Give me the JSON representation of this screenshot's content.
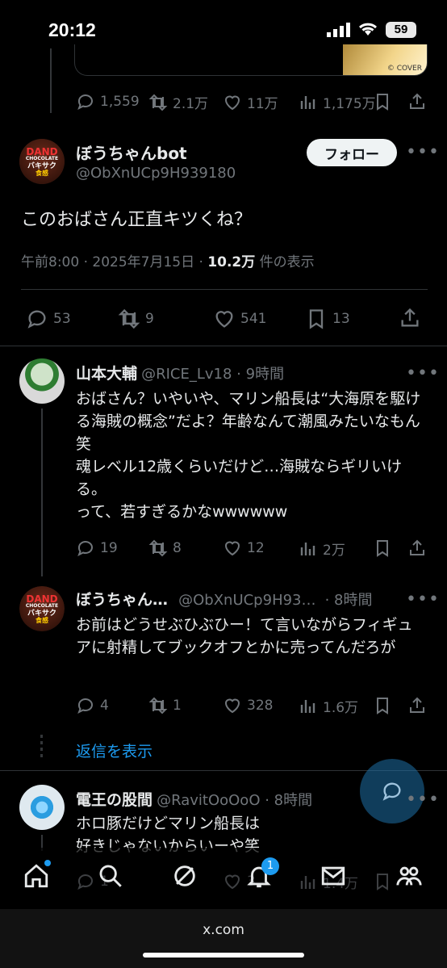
{
  "status": {
    "time": "20:12",
    "battery": "59"
  },
  "prev_tweet": {
    "media_credit": "© COVER",
    "actions": {
      "replies": "1,559",
      "retweets": "2.1万",
      "likes": "11万",
      "views": "1,175万"
    }
  },
  "main_tweet": {
    "avatar_text": [
      "DAND",
      "CHOCOLATE",
      "バキサク",
      "食感"
    ],
    "name": "ぼうちゃんbot",
    "handle": "@ObXnUCp9H939180",
    "follow_label": "フォロー",
    "text": "このおばさん正直キツくね？",
    "meta_time": "午前8:00 · 2025年7月15日 ·",
    "meta_views": "10.2万",
    "meta_suffix": "件の表示",
    "actions": {
      "replies": "53",
      "retweets": "9",
      "likes": "541",
      "bookmarks": "13"
    }
  },
  "replies": [
    {
      "name": "山本大輔",
      "handle": "@RICE_Lv18 · 9時間",
      "text": "おばさん？いやいや、マリン船長は“大海原を駆ける海賊の概念”だよ？年齢なんて潮風みたいなもん笑\n魂レベル12歳くらいだけど…海賊ならギリいける。\nって、若すぎるかなwwwwww",
      "actions": {
        "replies": "19",
        "retweets": "8",
        "likes": "12",
        "views": "2万"
      }
    },
    {
      "name": "ぼうちゃん…",
      "handle": "@ObXnUCp9H93…",
      "time": "· 8時間",
      "text": "お前はどうせぶひぶひー！て言いながらフィギュアに射精してブックオフとかに売ってんだろが",
      "actions": {
        "replies": "4",
        "retweets": "1",
        "likes": "328",
        "views": "1.6万"
      }
    },
    {
      "name": "電王の股間",
      "handle": "@RavitOoOoO · 8時間",
      "text": "ホロ豚だけどマリン船長は\n好きじゃないからいーや笑",
      "actions": {
        "replies": "1",
        "retweets": "",
        "likes": "3",
        "views": "1.4万"
      }
    }
  ],
  "show_replies_label": "返信を表示",
  "nav": {
    "notification_count": "1"
  },
  "browser": {
    "url": "x.com"
  },
  "colors": {
    "accent": "#1d9bf0",
    "muted": "#71767b",
    "background": "#000000"
  }
}
